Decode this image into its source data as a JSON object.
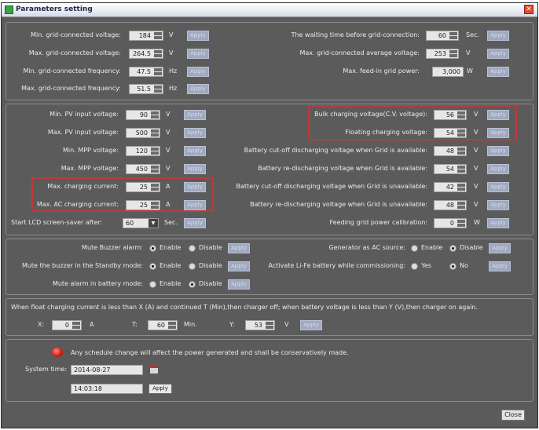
{
  "window": {
    "title": "Parameters setting"
  },
  "apply_label": "Apply",
  "grid": {
    "left": [
      {
        "label": "Min. grid-connected voltage:",
        "value": "184",
        "unit": "V"
      },
      {
        "label": "Max. grid-connected voltage:",
        "value": "264.5",
        "unit": "V"
      },
      {
        "label": "Min. grid-connected frequency:",
        "value": "47.5",
        "unit": "Hz"
      },
      {
        "label": "Max. grid-connected frequency:",
        "value": "51.5",
        "unit": "Hz"
      }
    ],
    "right": [
      {
        "label": "The waiting time before grid-connection:",
        "value": "60",
        "unit": "Sec."
      },
      {
        "label": "Max. grid-connected average voltage:",
        "value": "253",
        "unit": "V"
      },
      {
        "label": "Max. feed-in grid power:",
        "value": "3,000",
        "unit": "W"
      }
    ]
  },
  "pv": {
    "left": [
      {
        "label": "Min. PV input voltage:",
        "value": "90",
        "unit": "V"
      },
      {
        "label": "Max. PV input voltage:",
        "value": "500",
        "unit": "V"
      },
      {
        "label": "Min. MPP voltage:",
        "value": "120",
        "unit": "V"
      },
      {
        "label": "Max. MPP voltage:",
        "value": "450",
        "unit": "V"
      },
      {
        "label": "Max. charging current:",
        "value": "25",
        "unit": "A"
      },
      {
        "label": "Max. AC charging current:",
        "value": "25",
        "unit": "A"
      }
    ],
    "screensaver": {
      "label": "Start LCD screen-saver after:",
      "value": "60",
      "unit": "Sec."
    },
    "right": [
      {
        "label": "Bulk charging voltage(C.V. voltage):",
        "value": "56",
        "unit": "V"
      },
      {
        "label": "Floating charging voltage:",
        "value": "54",
        "unit": "V"
      },
      {
        "label": "Battery cut-off discharging voltage when Grid is available:",
        "value": "48",
        "unit": "V"
      },
      {
        "label": "Battery re-discharging voltage when Grid is available:",
        "value": "54",
        "unit": "V"
      },
      {
        "label": "Battery cut-off discharging voltage when Grid is unavailable:",
        "value": "42",
        "unit": "V"
      },
      {
        "label": "Battery re-discharging voltage when Grid is unavailable:",
        "value": "48",
        "unit": "V"
      },
      {
        "label": "Feeding grid power calibration:",
        "value": "0",
        "unit": "W"
      }
    ]
  },
  "options": {
    "left": [
      {
        "label": "Mute Buzzer alarm:",
        "opt1": "Enable",
        "opt2": "Disable",
        "selected": "Enable"
      },
      {
        "label": "Mute the buzzer in the Standby mode:",
        "opt1": "Enable",
        "opt2": "Disable",
        "selected": "Enable"
      },
      {
        "label": "Mute alarm in battery mode:",
        "opt1": "Enable",
        "opt2": "Disable",
        "selected": "Disable"
      }
    ],
    "right": [
      {
        "label": "Generator as AC source:",
        "opt1": "Enable",
        "opt2": "Disable",
        "selected": "Disable"
      },
      {
        "label": "Activate Li-Fe battery while commissioning:",
        "opt1": "Yes",
        "opt2": "No",
        "selected": "No"
      }
    ]
  },
  "float": {
    "text": "When float charging current is less than X (A) and continued T (Min),then charger off; when battery voltage is less than Y (V),then charger on again.",
    "x_label": "X:",
    "x_value": "0",
    "x_unit": "A",
    "t_label": "T:",
    "t_value": "60",
    "t_unit": "Min.",
    "y_label": "Y:",
    "y_value": "53",
    "y_unit": "V"
  },
  "schedule": {
    "warning": "Any schedule change will affect the power generated and shall be conservatively made.",
    "system_time_label": "System time:",
    "date": "2014-08-27",
    "time": "14:03:18",
    "apply": "Apply"
  },
  "close_label": "Close",
  "colors": {
    "highlight": "#c0383a",
    "background": "#5b5b5b",
    "apply_disabled": "#9fa9c0"
  }
}
